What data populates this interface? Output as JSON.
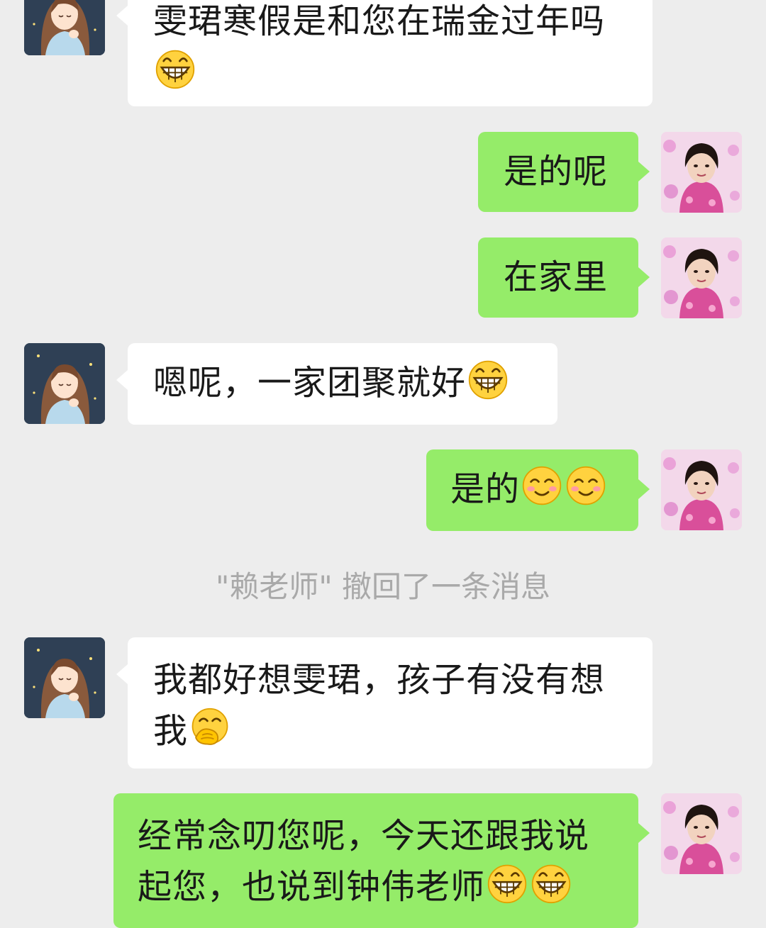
{
  "messages": {
    "m1": {
      "line1": "雯珺寒假是和您在瑞金过年吗",
      "emoji": "grinning-face"
    },
    "m2": {
      "text": "是的呢"
    },
    "m3": {
      "text": "在家里"
    },
    "m4": {
      "text": "嗯呢，一家团聚就好",
      "emoji": "grinning-face"
    },
    "m5": {
      "text": "是的",
      "emoji": "smiling-face-with-blush"
    },
    "m6": {
      "line1": "我都好想雯珺，孩子有没有想",
      "line2": "我",
      "emoji": "face-with-hand-over-mouth"
    },
    "m7": {
      "line1": "经常念叨您呢，今天还跟我说",
      "line2": "起您，也说到钟伟老师",
      "emoji": "grinning-face"
    }
  },
  "system_notice": "\"赖老师\" 撤回了一条消息",
  "colors": {
    "background": "#ededed",
    "incoming": "#ffffff",
    "outgoing": "#95ec69",
    "system_text": "#a9a9a9"
  }
}
